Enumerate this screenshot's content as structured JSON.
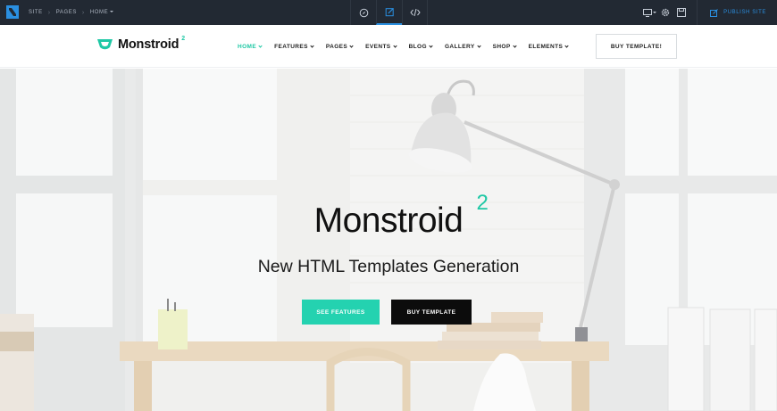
{
  "builder_bar": {
    "breadcrumbs": [
      "SITE",
      "PAGES",
      "HOME"
    ],
    "publish_label": "PUBLISH SITE",
    "accent": "#2a8fe0",
    "background": "#222933"
  },
  "header": {
    "brand_name": "Monstroid",
    "brand_sup": "2",
    "nav": [
      "HOME",
      "FEATURES",
      "PAGES",
      "EVENTS",
      "BLOG",
      "GALLERY",
      "SHOP",
      "ELEMENTS"
    ],
    "active_nav": "HOME",
    "buy_label": "BUY TEMPLATE!",
    "accent": "#1fc8a5"
  },
  "hero": {
    "title": "Monstroid",
    "title_sup": "2",
    "subtitle": "New HTML Templates Generation",
    "primary_button": "SEE FEATURES",
    "secondary_button": "BUY TEMPLATE",
    "primary_color": "#24d2b0",
    "secondary_color": "#0c0c0c"
  }
}
